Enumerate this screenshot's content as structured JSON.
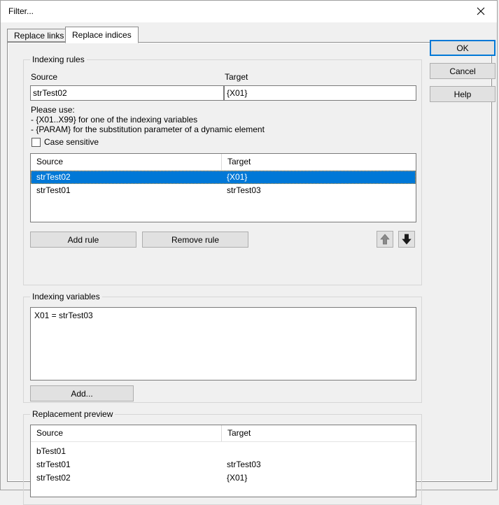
{
  "window": {
    "title": "Filter...",
    "close_icon": "close-icon"
  },
  "tabs": [
    {
      "label": "Replace links",
      "active": false
    },
    {
      "label": "Replace indices",
      "active": true
    }
  ],
  "dialog_buttons": {
    "ok": "OK",
    "cancel": "Cancel",
    "help": "Help"
  },
  "indexing_rules": {
    "group_title": "Indexing rules",
    "source_label": "Source",
    "target_label": "Target",
    "source_value": "strTest02",
    "target_value": "{X01}",
    "hint_line1": "Please use:",
    "hint_line2": "- {X01..X99} for one of the indexing variables",
    "hint_line3": "- {PARAM} for the substitution parameter of a dynamic element",
    "case_sensitive_label": "Case sensitive",
    "case_sensitive_checked": false,
    "columns": [
      "Source",
      "Target"
    ],
    "rows": [
      {
        "source": "strTest02",
        "target": "{X01}",
        "selected": true
      },
      {
        "source": "strTest01",
        "target": "strTest03",
        "selected": false
      }
    ],
    "add_rule_label": "Add rule",
    "remove_rule_label": "Remove rule",
    "move_up_icon": "arrow-up-icon",
    "move_down_icon": "arrow-down-icon",
    "move_up_enabled": false,
    "move_down_enabled": true
  },
  "indexing_variables": {
    "group_title": "Indexing variables",
    "lines": [
      "X01 = strTest03"
    ],
    "add_label": "Add..."
  },
  "replacement_preview": {
    "group_title": "Replacement preview",
    "columns": [
      "Source",
      "Target"
    ],
    "rows": [
      {
        "source": "bTest01",
        "target": ""
      },
      {
        "source": "strTest01",
        "target": "strTest03"
      },
      {
        "source": "strTest02",
        "target": "{X01}"
      }
    ]
  },
  "colors": {
    "accent": "#0078d7",
    "selection": "#0078d7",
    "dialog_bg": "#f0f0f0",
    "field_bg": "#ffffff",
    "disabled_arrow": "#8a8a8a",
    "enabled_arrow": "#1a1a1a"
  }
}
